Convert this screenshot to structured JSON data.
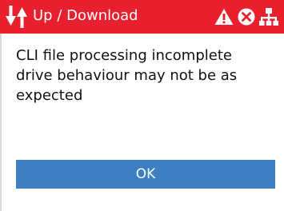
{
  "titlebar": {
    "icon": "up-down-arrows-icon",
    "title": "Up / Download",
    "background_color": "#e8202e",
    "status_icons": [
      "warning-icon",
      "error-icon",
      "network-icon"
    ]
  },
  "dialog": {
    "message": "CLI file processing incomplete\ndrive behaviour may not be as expected",
    "button_label": "OK",
    "button_color": "#3d7fc1"
  }
}
